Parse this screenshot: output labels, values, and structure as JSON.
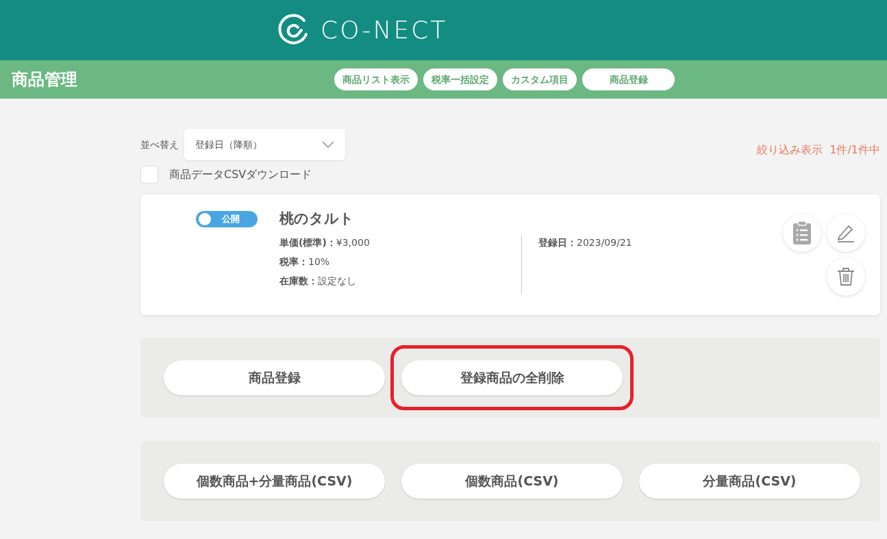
{
  "header": {
    "logo_text": "CO-NECT"
  },
  "subheader": {
    "title": "商品管理",
    "tabs": [
      {
        "label": "商品リスト表示"
      },
      {
        "label": "税率一括設定"
      },
      {
        "label": "カスタム項目"
      },
      {
        "label": "商品登録"
      }
    ]
  },
  "sort": {
    "label": "並べ替え",
    "value": "登録日（降順）"
  },
  "filter_count": "絞り込み表示  1件/1件中",
  "csv_download": {
    "label": "商品データCSVダウンロード",
    "checked": false
  },
  "products": [
    {
      "status": "公開",
      "on": true,
      "name": "桃のタルト",
      "details": [
        {
          "label": "単価(標準)：",
          "value": "¥3,000"
        },
        {
          "label": "税率：",
          "value": "10%"
        },
        {
          "label": "在庫数：",
          "value": "設定なし"
        }
      ],
      "registered": {
        "label": "登録日：",
        "value": "2023/09/21"
      }
    }
  ],
  "action_panels": [
    {
      "buttons": [
        {
          "label": "商品登録",
          "highlighted": false
        },
        {
          "label": "登録商品の全削除",
          "highlighted": true
        }
      ]
    },
    {
      "buttons": [
        {
          "label": "個数商品+分量商品(CSV)",
          "highlighted": false
        },
        {
          "label": "個数商品(CSV)",
          "highlighted": false
        },
        {
          "label": "分量商品(CSV)",
          "highlighted": false
        }
      ]
    }
  ]
}
